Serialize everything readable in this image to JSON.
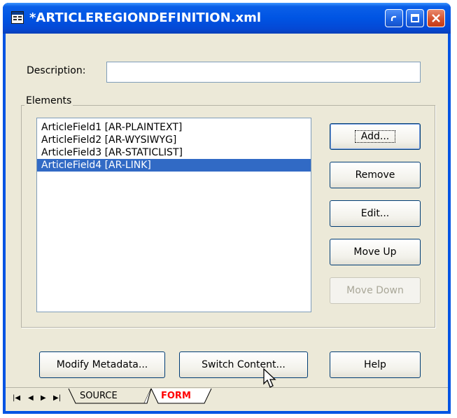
{
  "window": {
    "title": "*ARTICLEREGIONDEFINITION.xml",
    "icon": "xml-editor-icon"
  },
  "form": {
    "description_label": "Description:",
    "description_value": "",
    "elements_group_label": "Elements",
    "elements": [
      {
        "label": "ArticleField1 [AR-PLAINTEXT]",
        "selected": false
      },
      {
        "label": "ArticleField2 [AR-WYSIWYG]",
        "selected": false
      },
      {
        "label": "ArticleField3 [AR-STATICLIST]",
        "selected": false
      },
      {
        "label": "ArticleField4 [AR-LINK]",
        "selected": true
      }
    ],
    "buttons": {
      "add": "Add...",
      "remove": "Remove",
      "edit": "Edit...",
      "move_up": "Move Up",
      "move_down": "Move Down"
    },
    "bottom_buttons": {
      "modify_metadata": "Modify Metadata...",
      "switch_content": "Switch Content...",
      "help": "Help"
    }
  },
  "tabs": {
    "items": [
      {
        "label": "SOURCE",
        "active": false
      },
      {
        "label": "FORM",
        "active": true
      }
    ],
    "active_color": "#ff0000"
  },
  "colors": {
    "selection": "#316ac5",
    "titlebar": "#0054e3",
    "face": "#ece9d8"
  }
}
